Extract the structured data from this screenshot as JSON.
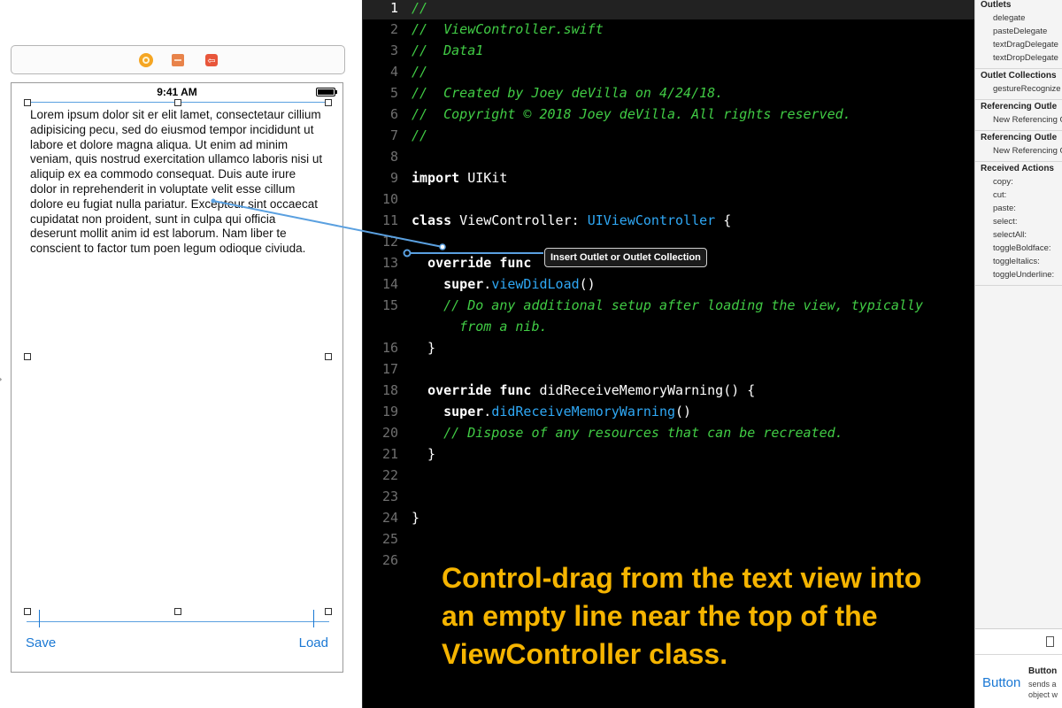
{
  "storyboard": {
    "status_time": "9:41 AM",
    "text_view": "Lorem ipsum dolor sit er elit lamet, consectetaur cillium adipisicing pecu, sed do eiusmod tempor incididunt ut labore et dolore magna aliqua. Ut enim ad minim veniam, quis nostrud exercitation ullamco laboris nisi ut aliquip ex ea commodo consequat. Duis aute irure dolor in reprehenderit in voluptate velit esse cillum dolore eu fugiat nulla pariatur. Excepteur sint occaecat cupidatat non proident, sunt in culpa qui officia deserunt mollit anim id est laborum. Nam liber te conscient to factor tum poen legum odioque civiuda.",
    "save_label": "Save",
    "load_label": "Load",
    "dock_icons": [
      "view-controller-icon",
      "first-responder-icon",
      "exit-icon"
    ]
  },
  "editor": {
    "current_line": 1,
    "lines": [
      {
        "n": "1",
        "text": "//",
        "style": "comment"
      },
      {
        "n": "2",
        "text": "//  ViewController.swift",
        "style": "comment"
      },
      {
        "n": "3",
        "text": "//  Data1",
        "style": "comment"
      },
      {
        "n": "4",
        "text": "//",
        "style": "comment"
      },
      {
        "n": "5",
        "text": "//  Created by Joey deVilla on 4/24/18.",
        "style": "comment"
      },
      {
        "n": "6",
        "text": "//  Copyright © 2018 Joey deVilla. All rights reserved.",
        "style": "comment"
      },
      {
        "n": "7",
        "text": "//",
        "style": "comment"
      },
      {
        "n": "8",
        "text": "",
        "style": "plain"
      },
      {
        "n": "9",
        "text": "import UIKit",
        "style": "plain"
      },
      {
        "n": "10",
        "text": "",
        "style": "plain"
      },
      {
        "n": "11",
        "text": "class ViewController: UIViewController {",
        "style": "plain"
      },
      {
        "n": "12",
        "text": "",
        "style": "plain"
      },
      {
        "n": "13",
        "text": "  override func ",
        "style": "plain"
      },
      {
        "n": "14",
        "text": "    super.viewDidLoad()",
        "style": "plain"
      },
      {
        "n": "15",
        "text": "    // Do any additional setup after loading the view, typically",
        "style": "comment"
      },
      {
        "n": "",
        "text": "      from a nib.",
        "style": "comment"
      },
      {
        "n": "16",
        "text": "  }",
        "style": "plain"
      },
      {
        "n": "17",
        "text": "",
        "style": "plain"
      },
      {
        "n": "18",
        "text": "  override func didReceiveMemoryWarning() {",
        "style": "plain"
      },
      {
        "n": "19",
        "text": "    super.didReceiveMemoryWarning()",
        "style": "plain"
      },
      {
        "n": "20",
        "text": "    // Dispose of any resources that can be recreated.",
        "style": "comment"
      },
      {
        "n": "21",
        "text": "  }",
        "style": "plain"
      },
      {
        "n": "22",
        "text": "",
        "style": "plain"
      },
      {
        "n": "23",
        "text": "",
        "style": "plain"
      },
      {
        "n": "24",
        "text": "}",
        "style": "plain"
      },
      {
        "n": "25",
        "text": "",
        "style": "plain"
      },
      {
        "n": "26",
        "text": "",
        "style": "plain"
      }
    ],
    "tooltip": "Insert Outlet or Outlet Collection",
    "caption": "Control-drag from the text view into an empty line near the top of the ViewController class.",
    "colors": {
      "comment": "#41cc45",
      "type": "#2fa8f5",
      "caption": "#f5b400"
    }
  },
  "inspector": {
    "sections": [
      {
        "title": "Outlets",
        "items": [
          "delegate",
          "pasteDelegate",
          "textDragDelegate",
          "textDropDelegate"
        ]
      },
      {
        "title": "Outlet Collections",
        "items": [
          "gestureRecognize"
        ]
      },
      {
        "title": "Referencing Outle",
        "items": [
          "New Referencing O"
        ]
      },
      {
        "title": "Referencing Outle",
        "items": [
          "New Referencing O"
        ]
      },
      {
        "title": "Received Actions",
        "items": [
          "copy:",
          "cut:",
          "paste:",
          "select:",
          "selectAll:",
          "toggleBoldface:",
          "toggleItalics:",
          "toggleUnderline:"
        ]
      }
    ],
    "library": {
      "button_label": "Button",
      "title": "Button",
      "desc_1": "sends a",
      "desc_2": "object w"
    }
  }
}
